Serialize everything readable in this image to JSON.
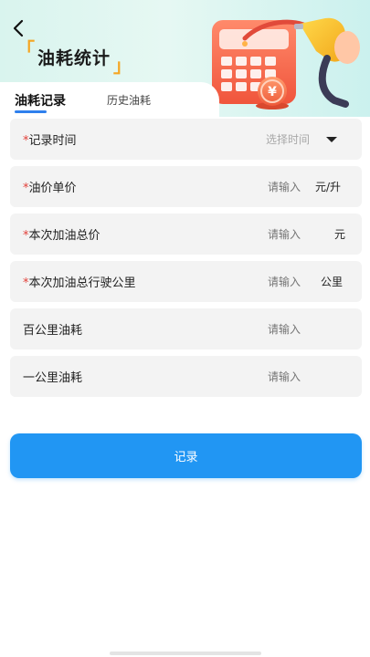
{
  "header": {
    "title": "油耗统计",
    "title_bracket_left": "「",
    "title_bracket_right": "」",
    "illustration_icon": "fuel-calculator-illustration",
    "currency_symbol": "¥"
  },
  "tabs": [
    {
      "label": "油耗记录",
      "active": true
    },
    {
      "label": "历史油耗",
      "active": false
    }
  ],
  "form": {
    "rows": [
      {
        "required_mark": "*",
        "label": "记录时间",
        "placeholder": "选择时间",
        "unit": "",
        "type": "select"
      },
      {
        "required_mark": "*",
        "label": "油价单价",
        "placeholder": "请输入",
        "unit": "元/升",
        "type": "input"
      },
      {
        "required_mark": "*",
        "label": "本次加油总价",
        "placeholder": "请输入",
        "unit": "元",
        "type": "input"
      },
      {
        "required_mark": "*",
        "label": "本次加油总行驶公里",
        "placeholder": "请输入",
        "unit": "公里",
        "type": "input"
      },
      {
        "required_mark": "",
        "label": "百公里油耗",
        "placeholder": "请输入",
        "unit": "",
        "type": "input"
      },
      {
        "required_mark": "",
        "label": "一公里油耗",
        "placeholder": "请输入",
        "unit": "",
        "type": "input"
      }
    ]
  },
  "submit_label": "记录",
  "colors": {
    "accent": "#2196f3",
    "tab_underline": "#2f80ed",
    "required": "#e2403a",
    "title_bracket": "#f5a623",
    "row_background": "#f3f3f3",
    "placeholder": "#a8a8a8"
  }
}
